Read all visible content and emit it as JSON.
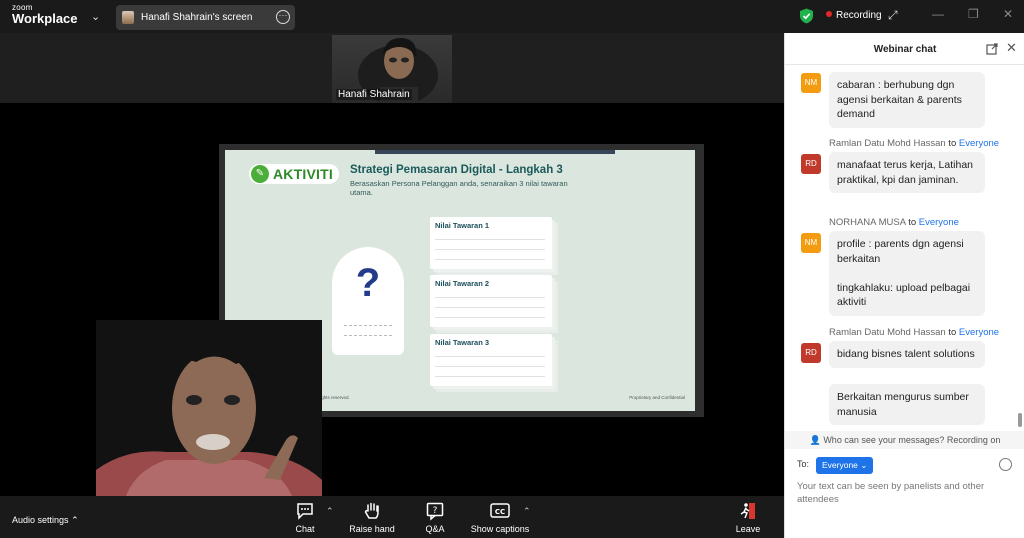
{
  "app": {
    "logo_top": "zoom",
    "logo_bottom": "Workplace"
  },
  "share": {
    "label": "Hanafi Shahrain's screen"
  },
  "status": {
    "recording": "Recording"
  },
  "colors": {
    "accent": "#1e73e8",
    "record": "#e02828",
    "shield": "#22b14c",
    "avatar_nm": "#f39c12",
    "avatar_rd": "#c0392b"
  },
  "videos": {
    "top_name": "Hanafi Shahrain"
  },
  "slide": {
    "badge": "AKTIVITI",
    "title": "Strategi Pemasaran Digital - Langkah 3",
    "subtitle": "Berasaskan Persona Pelanggan anda, senaraikan 3 nilai tawaran utama.",
    "cards": [
      "Nilai Tawaran 1",
      "Nilai Tawaran 2",
      "Nilai Tawaran 3"
    ],
    "footer_left": "Services. All rights reserved.",
    "footer_right": "Proprietary and Confidential",
    "question_mark": "?"
  },
  "toolbar": {
    "audio_settings": "Audio settings",
    "chat": "Chat",
    "raise_hand": "Raise hand",
    "qa": "Q&A",
    "show_captions": "Show captions",
    "leave": "Leave"
  },
  "chat": {
    "title": "Webinar chat",
    "to_word": "to",
    "messages": [
      {
        "initials": "NM",
        "text": "cabaran : berhubung dgn agensi berkaitan & parents demand"
      },
      {
        "sender": "Ramlan Datu Mohd Hassan",
        "recipient": "Everyone",
        "initials": "RD",
        "text": "manafaat terus kerja, Latihan praktikal, kpi dan jaminan."
      },
      {
        "sender": "NORHANA MUSA",
        "recipient": "Everyone",
        "initials": "NM",
        "text": "profile : parents dgn agensi berkaitan\n\ntingkahlaku: upload pelbagai aktiviti"
      },
      {
        "sender": "Ramlan Datu Mohd Hassan",
        "recipient": "Everyone",
        "initials": "RD",
        "text": "bidang bisnes talent solutions",
        "text2": "Berkaitan mengurus sumber manusia"
      }
    ],
    "notice": "Who can see your messages? Recording on",
    "to_label": "To:",
    "to_value": "Everyone",
    "placeholder": "Your text can be seen by panelists and other attendees"
  }
}
